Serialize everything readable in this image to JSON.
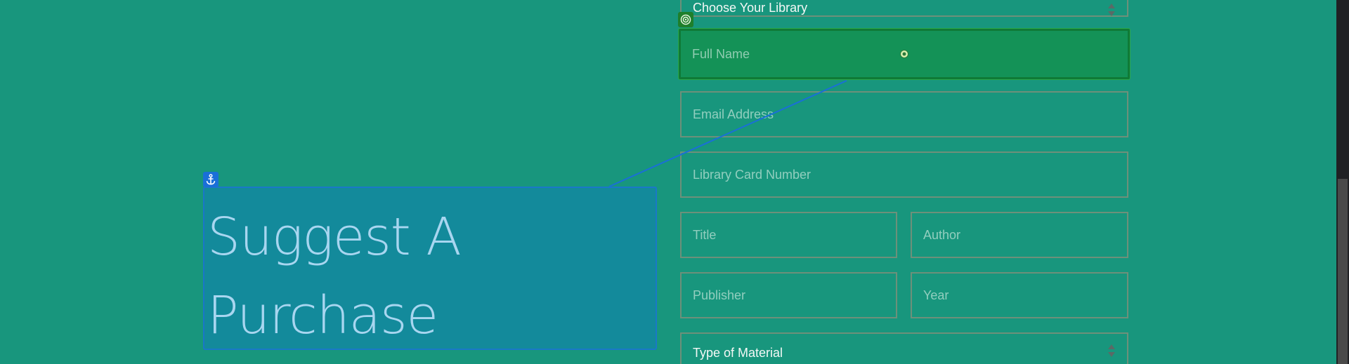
{
  "form": {
    "library_select_value": "Choose Your Library",
    "full_name_placeholder": "Full Name",
    "email_placeholder": "Email Address",
    "card_placeholder": "Library Card Number",
    "title_placeholder": "Title",
    "author_placeholder": "Author",
    "publisher_placeholder": "Publisher",
    "year_placeholder": "Year",
    "material_select_value": "Type of Material"
  },
  "heading": {
    "line1": "Suggest A",
    "line2": "Purchase"
  },
  "icons": {
    "target_badge": "target-icon",
    "anchor_badge": "anchor-icon",
    "center_marker": "center-dot-icon",
    "select_arrows": "sort-arrows-icon"
  },
  "colors": {
    "page_background": "#18967d",
    "field_border": "#b48c78",
    "active_field_background": "#149257",
    "active_field_border": "#0f7a36",
    "heading_box_background": "#138a9b",
    "heading_box_border": "#1a78c8",
    "heading_text": "#a8d6f0",
    "connector_line": "#1a6fd8"
  }
}
